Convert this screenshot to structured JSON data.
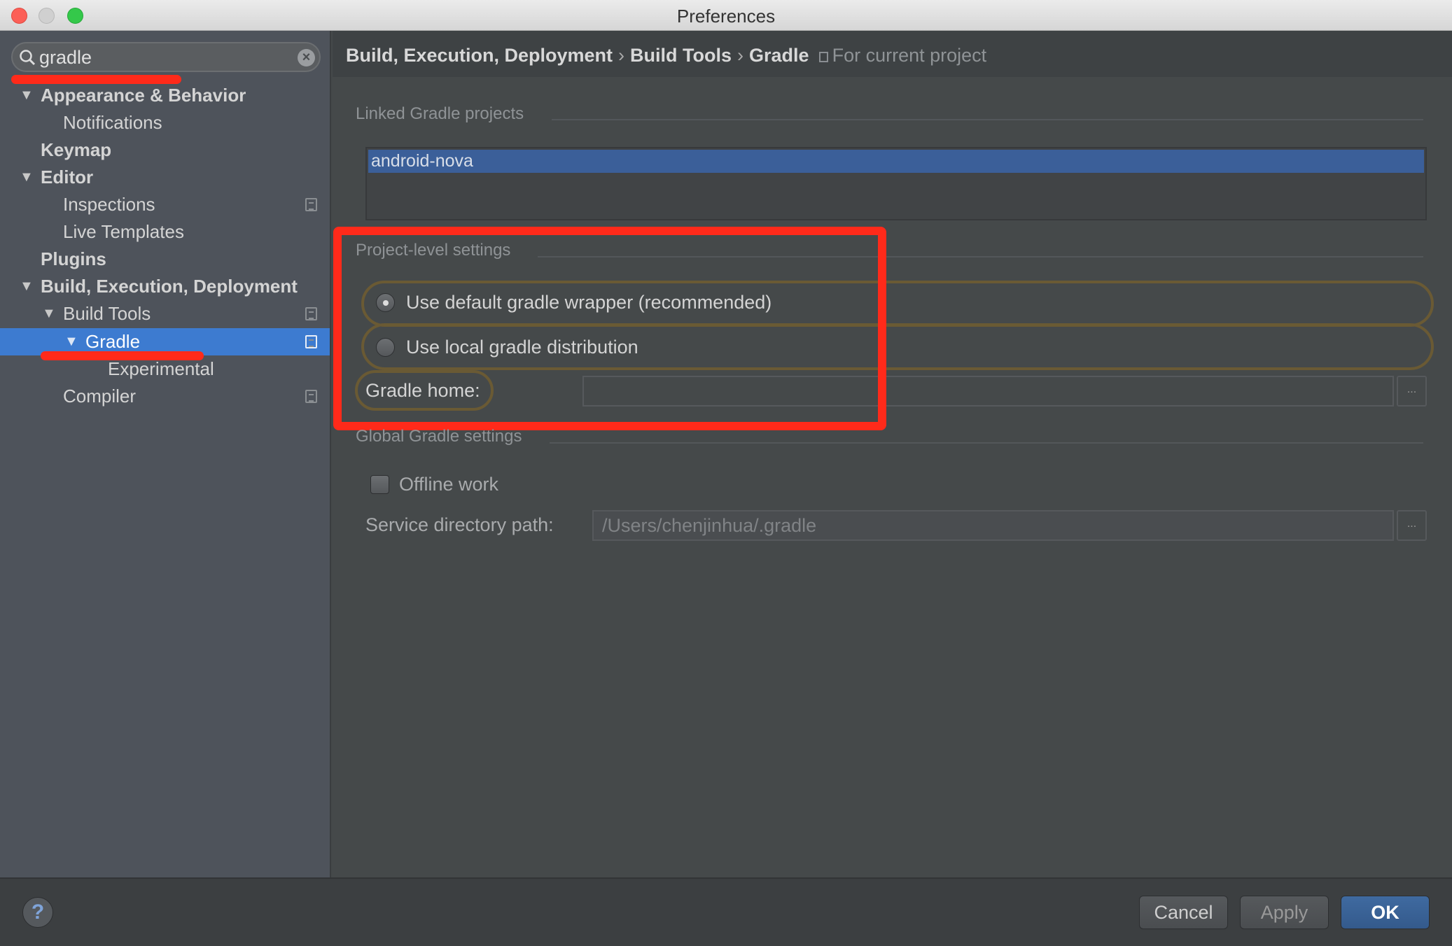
{
  "window": {
    "title": "Preferences"
  },
  "search": {
    "value": "gradle",
    "icon": "search-icon",
    "clear_icon": "clear-icon"
  },
  "tree": [
    {
      "label": "Appearance & Behavior",
      "level": 0,
      "expanded": true,
      "bold": true
    },
    {
      "label": "Notifications",
      "level": 1
    },
    {
      "label": "Keymap",
      "level": 0,
      "bold": true
    },
    {
      "label": "Editor",
      "level": 0,
      "expanded": true,
      "bold": true
    },
    {
      "label": "Inspections",
      "level": 1,
      "project_icon": true
    },
    {
      "label": "Live Templates",
      "level": 1
    },
    {
      "label": "Plugins",
      "level": 0,
      "bold": true
    },
    {
      "label": "Build, Execution, Deployment",
      "level": 0,
      "expanded": true,
      "bold": true
    },
    {
      "label": "Build Tools",
      "level": 1,
      "expanded": true,
      "project_icon": true
    },
    {
      "label": "Gradle",
      "level": 2,
      "expanded": true,
      "selected": true,
      "project_icon": true
    },
    {
      "label": "Experimental",
      "level": 3
    },
    {
      "label": "Compiler",
      "level": 1,
      "project_icon": true
    }
  ],
  "breadcrumb": {
    "items": [
      "Build, Execution, Deployment",
      "Build Tools",
      "Gradle"
    ],
    "separator": "›",
    "scope": "For current project"
  },
  "linked": {
    "title": "Linked Gradle projects",
    "projects": [
      "android-nova"
    ]
  },
  "project_level": {
    "title": "Project-level settings",
    "options": [
      {
        "label": "Use default gradle wrapper (recommended)",
        "selected": true
      },
      {
        "label": "Use local gradle distribution",
        "selected": false
      }
    ],
    "gradle_home_label": "Gradle home:",
    "gradle_home_value": "",
    "browse": "..."
  },
  "global": {
    "title": "Global Gradle settings",
    "offline_label": "Offline work",
    "offline_checked": false,
    "service_label": "Service directory path:",
    "service_value": "/Users/chenjinhua/.gradle",
    "browse": "..."
  },
  "footer": {
    "help": "?",
    "cancel": "Cancel",
    "apply": "Apply",
    "ok": "OK"
  },
  "colors": {
    "selection": "#3d7bd0",
    "annotation": "#ff2a1a",
    "highlight": "#6a5a34"
  }
}
